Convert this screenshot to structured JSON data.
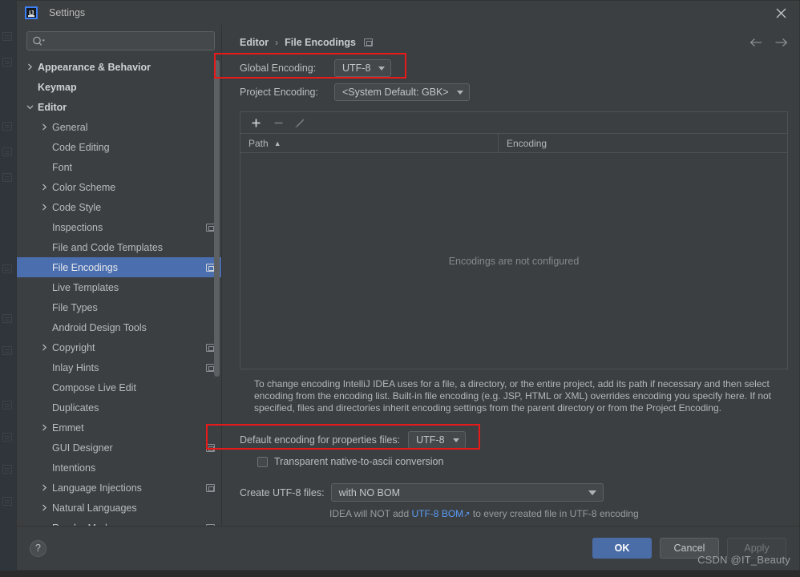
{
  "window": {
    "title": "Settings",
    "logo_icon": "intellij-idea-logo-icon",
    "close_icon": "close-icon"
  },
  "sidebar": {
    "search": {
      "placeholder": "",
      "icon": "search-icon"
    },
    "items": [
      {
        "label": "Appearance & Behavior",
        "twisty": "right",
        "bold": true,
        "indent": 0,
        "badge": false,
        "selected": false
      },
      {
        "label": "Keymap",
        "twisty": "none",
        "bold": true,
        "indent": 0,
        "badge": false,
        "selected": false
      },
      {
        "label": "Editor",
        "twisty": "down",
        "bold": true,
        "indent": 0,
        "badge": false,
        "selected": false
      },
      {
        "label": "General",
        "twisty": "right",
        "bold": false,
        "indent": 1,
        "badge": false,
        "selected": false
      },
      {
        "label": "Code Editing",
        "twisty": "none",
        "bold": false,
        "indent": 1,
        "badge": false,
        "selected": false
      },
      {
        "label": "Font",
        "twisty": "none",
        "bold": false,
        "indent": 1,
        "badge": false,
        "selected": false
      },
      {
        "label": "Color Scheme",
        "twisty": "right",
        "bold": false,
        "indent": 1,
        "badge": false,
        "selected": false
      },
      {
        "label": "Code Style",
        "twisty": "right",
        "bold": false,
        "indent": 1,
        "badge": false,
        "selected": false
      },
      {
        "label": "Inspections",
        "twisty": "none",
        "bold": false,
        "indent": 1,
        "badge": true,
        "selected": false
      },
      {
        "label": "File and Code Templates",
        "twisty": "none",
        "bold": false,
        "indent": 1,
        "badge": false,
        "selected": false
      },
      {
        "label": "File Encodings",
        "twisty": "none",
        "bold": false,
        "indent": 1,
        "badge": true,
        "selected": true
      },
      {
        "label": "Live Templates",
        "twisty": "none",
        "bold": false,
        "indent": 1,
        "badge": false,
        "selected": false
      },
      {
        "label": "File Types",
        "twisty": "none",
        "bold": false,
        "indent": 1,
        "badge": false,
        "selected": false
      },
      {
        "label": "Android Design Tools",
        "twisty": "none",
        "bold": false,
        "indent": 1,
        "badge": false,
        "selected": false
      },
      {
        "label": "Copyright",
        "twisty": "right",
        "bold": false,
        "indent": 1,
        "badge": true,
        "selected": false
      },
      {
        "label": "Inlay Hints",
        "twisty": "none",
        "bold": false,
        "indent": 1,
        "badge": true,
        "selected": false
      },
      {
        "label": "Compose Live Edit",
        "twisty": "none",
        "bold": false,
        "indent": 1,
        "badge": false,
        "selected": false
      },
      {
        "label": "Duplicates",
        "twisty": "none",
        "bold": false,
        "indent": 1,
        "badge": false,
        "selected": false
      },
      {
        "label": "Emmet",
        "twisty": "right",
        "bold": false,
        "indent": 1,
        "badge": false,
        "selected": false
      },
      {
        "label": "GUI Designer",
        "twisty": "none",
        "bold": false,
        "indent": 1,
        "badge": true,
        "selected": false
      },
      {
        "label": "Intentions",
        "twisty": "none",
        "bold": false,
        "indent": 1,
        "badge": false,
        "selected": false
      },
      {
        "label": "Language Injections",
        "twisty": "right",
        "bold": false,
        "indent": 1,
        "badge": true,
        "selected": false
      },
      {
        "label": "Natural Languages",
        "twisty": "right",
        "bold": false,
        "indent": 1,
        "badge": false,
        "selected": false
      },
      {
        "label": "Reader Mode",
        "twisty": "none",
        "bold": false,
        "indent": 1,
        "badge": true,
        "selected": false
      }
    ]
  },
  "content": {
    "breadcrumb": {
      "parent": "Editor",
      "separator": "›",
      "current": "File Encodings",
      "badge_icon": "project-level-settings-icon"
    },
    "nav": {
      "back_icon": "arrow-left-icon",
      "forward_icon": "arrow-right-icon"
    },
    "global_encoding": {
      "label": "Global Encoding:",
      "value": "UTF-8"
    },
    "project_encoding": {
      "label": "Project Encoding:",
      "value": "<System Default: GBK>"
    },
    "table": {
      "toolbar": {
        "add_icon": "plus-icon",
        "remove_icon": "minus-icon",
        "edit_icon": "pencil-icon"
      },
      "columns": [
        "Path",
        "Encoding"
      ],
      "sort_indicator": "▲",
      "rows": [],
      "empty_message": "Encodings are not configured"
    },
    "help_text": "To change encoding IntelliJ IDEA uses for a file, a directory, or the entire project, add its path if necessary and then select encoding from the encoding list. Built-in file encoding (e.g. JSP, HTML or XML) overrides encoding you specify here. If not specified, files and directories inherit encoding settings from the parent directory or from the Project Encoding.",
    "properties_encoding": {
      "label": "Default encoding for properties files:",
      "value": "UTF-8"
    },
    "transparent_checkbox": {
      "label": "Transparent native-to-ascii conversion",
      "checked": false
    },
    "create_utf8": {
      "label": "Create UTF-8 files:",
      "value": "with NO BOM"
    },
    "bom_note": {
      "prefix": "IDEA will NOT add ",
      "link": "UTF-8 BOM",
      "link_icon": "↗",
      "suffix": " to every created file in UTF-8 encoding"
    }
  },
  "footer": {
    "help_label": "?",
    "ok_label": "OK",
    "cancel_label": "Cancel",
    "apply_label": "Apply",
    "watermark": "CSDN @IT_Beauty"
  },
  "colors": {
    "panel_bg": "#3c3f41",
    "selection_blue": "#4b6eaf",
    "accent_link": "#5a9cf8",
    "annotation_red": "#e81919",
    "primary_button": "#4a6da7"
  }
}
